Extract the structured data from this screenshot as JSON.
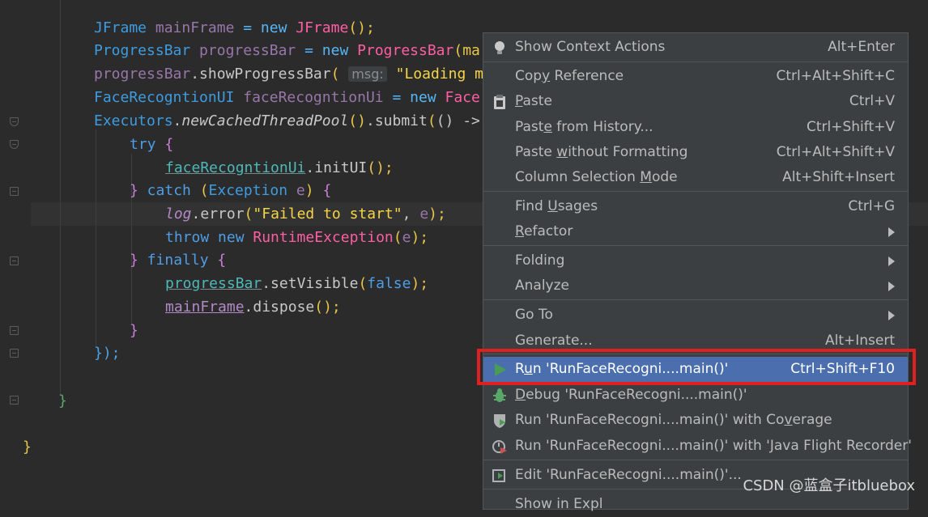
{
  "editor": {
    "lines": [
      {
        "id": "l1",
        "tokens": [
          {
            "t": "JFrame",
            "c": "cls"
          },
          {
            "t": " mainFrame ",
            "c": "var"
          },
          {
            "t": "=",
            "c": "kw2"
          },
          {
            "t": " new ",
            "c": "kw2"
          },
          {
            "t": "JFrame",
            "c": "ctor"
          },
          {
            "t": "();",
            "c": "paren-y"
          }
        ]
      },
      {
        "id": "l2",
        "tokens": [
          {
            "t": "ProgressBar",
            "c": "cls"
          },
          {
            "t": " progressBar ",
            "c": "var"
          },
          {
            "t": "=",
            "c": "kw2"
          },
          {
            "t": " new ",
            "c": "kw2"
          },
          {
            "t": "ProgressBar",
            "c": "ctor"
          },
          {
            "t": "(ma",
            "c": "paren-y"
          }
        ]
      },
      {
        "id": "l3",
        "tokens": [
          {
            "t": "progressBar",
            "c": "var"
          },
          {
            "t": ".showProgressBar",
            "c": "meth"
          },
          {
            "t": "( ",
            "c": "paren-y"
          },
          {
            "t": "msg:",
            "c": "hint"
          },
          {
            "t": " \"Loading mo",
            "c": "str"
          }
        ]
      },
      {
        "id": "l4",
        "tokens": [
          {
            "t": "FaceRecogntionUI",
            "c": "cls"
          },
          {
            "t": " faceRecogntionUi ",
            "c": "var"
          },
          {
            "t": "=",
            "c": "kw2"
          },
          {
            "t": " new ",
            "c": "kw2"
          },
          {
            "t": "Face",
            "c": "ctor"
          }
        ]
      },
      {
        "id": "l5",
        "tokens": [
          {
            "t": "Executors",
            "c": "cls"
          },
          {
            "t": ".",
            "c": "meth"
          },
          {
            "t": "newCachedThreadPool",
            "c": "meth ital"
          },
          {
            "t": "()",
            "c": "paren-y"
          },
          {
            "t": ".submit",
            "c": "meth"
          },
          {
            "t": "(",
            "c": "paren-y"
          },
          {
            "t": "() ->",
            "c": "meth"
          }
        ]
      },
      {
        "id": "l6",
        "tokens": [
          {
            "t": "try",
            "c": "kw3"
          },
          {
            "t": " {",
            "c": "paren-p"
          }
        ]
      },
      {
        "id": "l7",
        "tokens": [
          {
            "t": "faceRecogntionUi",
            "c": "var-u"
          },
          {
            "t": ".initUI",
            "c": "meth"
          },
          {
            "t": "();",
            "c": "paren-y"
          }
        ]
      },
      {
        "id": "l8",
        "tokens": [
          {
            "t": "}",
            "c": "paren-p"
          },
          {
            "t": " catch ",
            "c": "kw3"
          },
          {
            "t": "(",
            "c": "paren-y"
          },
          {
            "t": "Exception",
            "c": "cls"
          },
          {
            "t": " e",
            "c": "var"
          },
          {
            "t": ") ",
            "c": "paren-y"
          },
          {
            "t": "{",
            "c": "paren-p"
          }
        ]
      },
      {
        "id": "l9",
        "tokens": [
          {
            "t": "log",
            "c": "logv"
          },
          {
            "t": ".error",
            "c": "meth"
          },
          {
            "t": "(",
            "c": "paren-y"
          },
          {
            "t": "\"Failed to start\"",
            "c": "str"
          },
          {
            "t": ", ",
            "c": "meth"
          },
          {
            "t": "e",
            "c": "var"
          },
          {
            "t": ");",
            "c": "paren-y"
          }
        ]
      },
      {
        "id": "l10",
        "tokens": [
          {
            "t": "throw",
            "c": "kw3"
          },
          {
            "t": " new ",
            "c": "kw3"
          },
          {
            "t": "RuntimeException",
            "c": "ctor"
          },
          {
            "t": "(",
            "c": "paren-y"
          },
          {
            "t": "e",
            "c": "var"
          },
          {
            "t": ");",
            "c": "paren-y"
          }
        ]
      },
      {
        "id": "l11",
        "tokens": [
          {
            "t": "}",
            "c": "paren-p"
          },
          {
            "t": " finally ",
            "c": "kw3"
          },
          {
            "t": "{",
            "c": "paren-p"
          }
        ]
      },
      {
        "id": "l12",
        "tokens": [
          {
            "t": "progressBar",
            "c": "var-u"
          },
          {
            "t": ".setVisible",
            "c": "meth"
          },
          {
            "t": "(",
            "c": "paren-y"
          },
          {
            "t": "false",
            "c": "kw3"
          },
          {
            "t": ");",
            "c": "paren-y"
          }
        ]
      },
      {
        "id": "l13",
        "tokens": [
          {
            "t": "mainFrame",
            "c": "var-e"
          },
          {
            "t": ".dispose",
            "c": "meth"
          },
          {
            "t": "();",
            "c": "paren-y"
          }
        ]
      },
      {
        "id": "l14",
        "tokens": [
          {
            "t": "}",
            "c": "paren-p"
          }
        ]
      },
      {
        "id": "l15",
        "tokens": [
          {
            "t": "});",
            "c": "paren-b"
          }
        ]
      },
      {
        "id": "l16",
        "tokens": [
          {
            "t": "}",
            "c": "paren-g"
          }
        ]
      },
      {
        "id": "l17",
        "tokens": [
          {
            "t": "}",
            "c": "paren-y"
          }
        ]
      }
    ]
  },
  "context_menu": {
    "show_context_actions": {
      "label": "Show Context Actions",
      "shortcut": "Alt+Enter",
      "icon": "lightbulb-icon"
    },
    "copy_reference": {
      "label_pre": "Cop",
      "label_u": "y",
      "label_post": " Reference",
      "shortcut": "Ctrl+Alt+Shift+C"
    },
    "paste": {
      "label_pre": "",
      "label_u": "P",
      "label_post": "aste",
      "shortcut": "Ctrl+V",
      "icon": "clipboard-icon"
    },
    "paste_history": {
      "label_pre": "Past",
      "label_u": "e",
      "label_post": " from History...",
      "shortcut": "Ctrl+Shift+V"
    },
    "paste_no_format": {
      "label_pre": "Paste ",
      "label_u": "w",
      "label_post": "ithout Formatting",
      "shortcut": "Ctrl+Alt+Shift+V"
    },
    "column_selection": {
      "label_pre": "Column Selection ",
      "label_u": "M",
      "label_post": "ode",
      "shortcut": "Alt+Shift+Insert"
    },
    "find_usages": {
      "label_pre": "Find ",
      "label_u": "U",
      "label_post": "sages",
      "shortcut": "Ctrl+G"
    },
    "refactor": {
      "label_pre": "",
      "label_u": "R",
      "label_post": "efactor"
    },
    "folding": {
      "label": "Folding"
    },
    "analyze": {
      "label": "Analyze"
    },
    "go_to": {
      "label": "Go To"
    },
    "generate": {
      "label": "Generate...",
      "shortcut": "Alt+Insert"
    },
    "run": {
      "label_pre": "R",
      "label_u": "u",
      "label_post": "n 'RunFaceRecogni....main()'",
      "shortcut": "Ctrl+Shift+F10",
      "icon": "run-play-icon"
    },
    "debug": {
      "label_pre": "",
      "label_u": "D",
      "label_post": "ebug 'RunFaceRecogni....main()'",
      "icon": "debug-bug-icon"
    },
    "coverage": {
      "label_pre": "Run 'RunFaceRecogni....main()' with Co",
      "label_u": "v",
      "label_post": "erage",
      "icon": "coverage-shield-icon"
    },
    "flight_recorder": {
      "label": "Run 'RunFaceRecogni....main()' with 'Java Flight Recorder'",
      "icon": "flight-recorder-icon"
    },
    "edit_config": {
      "label": "Edit 'RunFaceRecogni....main()'...",
      "icon": "edit-config-icon"
    },
    "cut_item": {
      "label": "Show in Expl"
    }
  },
  "watermark": "CSDN @蓝盒子itbluebox",
  "colors": {
    "menu_bg": "#3c3f41",
    "selection": "#4b6eaf",
    "highlight_box": "#e02020",
    "editor_bg": "#2b2b2b"
  }
}
